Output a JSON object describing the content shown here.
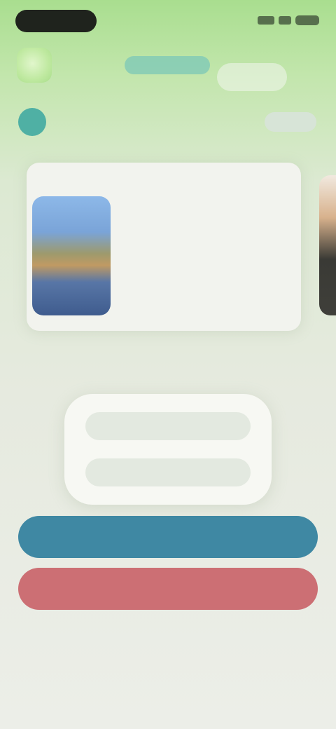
{
  "status_bar": {
    "icons": [
      "signal-icon",
      "wifi-icon",
      "battery-icon"
    ]
  },
  "header": {
    "logo_icon": "app-logo-icon"
  },
  "user": {
    "avatar_initial": "",
    "name": "",
    "action_label": ""
  },
  "card": {
    "title": "",
    "subtitle": "",
    "description": ""
  },
  "section": {
    "heading": "",
    "left_label": "",
    "right_label": "",
    "right_label_2": ""
  },
  "options": [
    {
      "label": ""
    },
    {
      "label": ""
    }
  ],
  "buttons": {
    "primary_label": "",
    "danger_label": ""
  },
  "footer": {
    "note": ""
  },
  "colors": {
    "primary": "#3f88a3",
    "danger": "#cc6f74",
    "accent_green": "#a9de8f",
    "avatar": "#4fb0a4"
  }
}
